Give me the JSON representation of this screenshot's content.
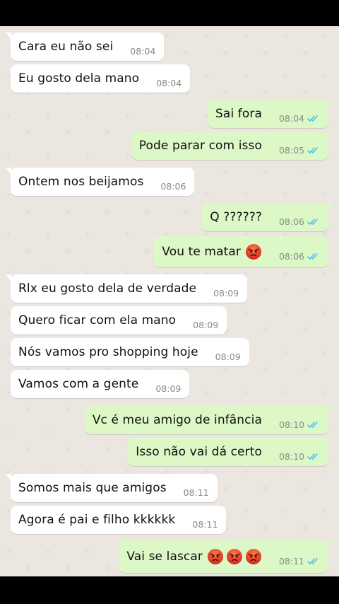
{
  "colors": {
    "incoming_bubble": "#ffffff",
    "outgoing_bubble": "#dcf8c6",
    "chat_background": "#ebe7e0",
    "read_ticks": "#53bdeb",
    "time_text": "#8a8a8a"
  },
  "messages": [
    {
      "text": "Cara eu não sei",
      "time": "08:04",
      "direction": "incoming"
    },
    {
      "text": "Eu gosto dela mano",
      "time": "08:04",
      "direction": "incoming"
    },
    {
      "text": "Sai fora",
      "time": "08:04",
      "direction": "outgoing",
      "status": "read"
    },
    {
      "text": "Pode parar com isso",
      "time": "08:05",
      "direction": "outgoing",
      "status": "read"
    },
    {
      "text": "Ontem nos beijamos",
      "time": "08:06",
      "direction": "incoming"
    },
    {
      "text": "Q ??????",
      "time": "08:06",
      "direction": "outgoing",
      "status": "read"
    },
    {
      "text": "Vou te matar",
      "time": "08:06",
      "direction": "outgoing",
      "status": "read",
      "emoji": "angry-face"
    },
    {
      "text": "Rlx eu gosto dela de verdade",
      "time": "08:09",
      "direction": "incoming"
    },
    {
      "text": "Quero ficar com ela mano",
      "time": "08:09",
      "direction": "incoming"
    },
    {
      "text": "Nós vamos pro shopping hoje",
      "time": "08:09",
      "direction": "incoming"
    },
    {
      "text": "Vamos com a gente",
      "time": "08:09",
      "direction": "incoming"
    },
    {
      "text": "Vc é meu amigo de infância",
      "time": "08:10",
      "direction": "outgoing",
      "status": "read"
    },
    {
      "text": "Isso não vai dá certo",
      "time": "08:10",
      "direction": "outgoing",
      "status": "read"
    },
    {
      "text": "Somos mais que amigos",
      "time": "08:11",
      "direction": "incoming"
    },
    {
      "text": "Agora é pai e filho kkkkkk",
      "time": "08:11",
      "direction": "incoming"
    },
    {
      "text": "Vai se lascar",
      "time": "08:11",
      "direction": "outgoing",
      "status": "read",
      "emoji": "angry-face",
      "emoji_count": 3
    }
  ]
}
